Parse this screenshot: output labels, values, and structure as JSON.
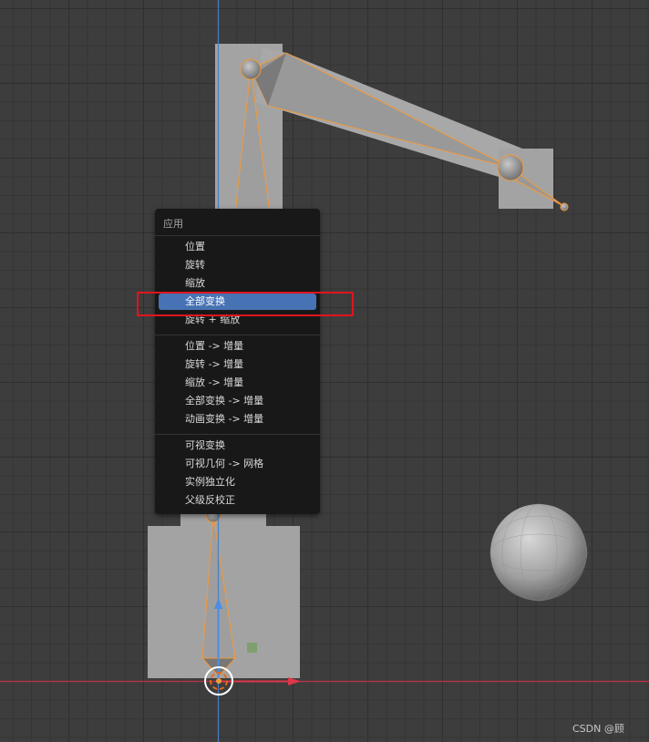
{
  "colors": {
    "viewport_bg": "#3d3d3d",
    "grid_line": "#353535",
    "grid_line_major": "#2f2f2f",
    "x_axis": "#c0334a",
    "y_axis": "#4a7fc1",
    "mesh": "#a3a3a3",
    "bone_outline": "#f39a3a",
    "bone_fill": "#9b9b9b",
    "menu_bg": "#181818",
    "menu_active": "#4772b3",
    "highlight_box": "#e0141e"
  },
  "menu": {
    "title": "应用",
    "items": [
      {
        "label": "位置",
        "active": false
      },
      {
        "label": "旋转",
        "active": false
      },
      {
        "label": "缩放",
        "active": false
      },
      {
        "label": "全部变换",
        "active": true
      },
      {
        "label": "旋转 + 缩放",
        "active": false
      },
      {
        "label": "位置 -> 增量",
        "active": false
      },
      {
        "label": "旋转 -> 增量",
        "active": false
      },
      {
        "label": "缩放 -> 增量",
        "active": false
      },
      {
        "label": "全部变换 -> 增量",
        "active": false
      },
      {
        "label": "动画变换 -> 增量",
        "active": false
      },
      {
        "label": "可视变换",
        "active": false
      },
      {
        "label": "可视几何 -> 网格",
        "active": false
      },
      {
        "label": "实例独立化",
        "active": false
      },
      {
        "label": "父级反校正",
        "active": false
      }
    ]
  },
  "watermark": "CSDN @顾"
}
